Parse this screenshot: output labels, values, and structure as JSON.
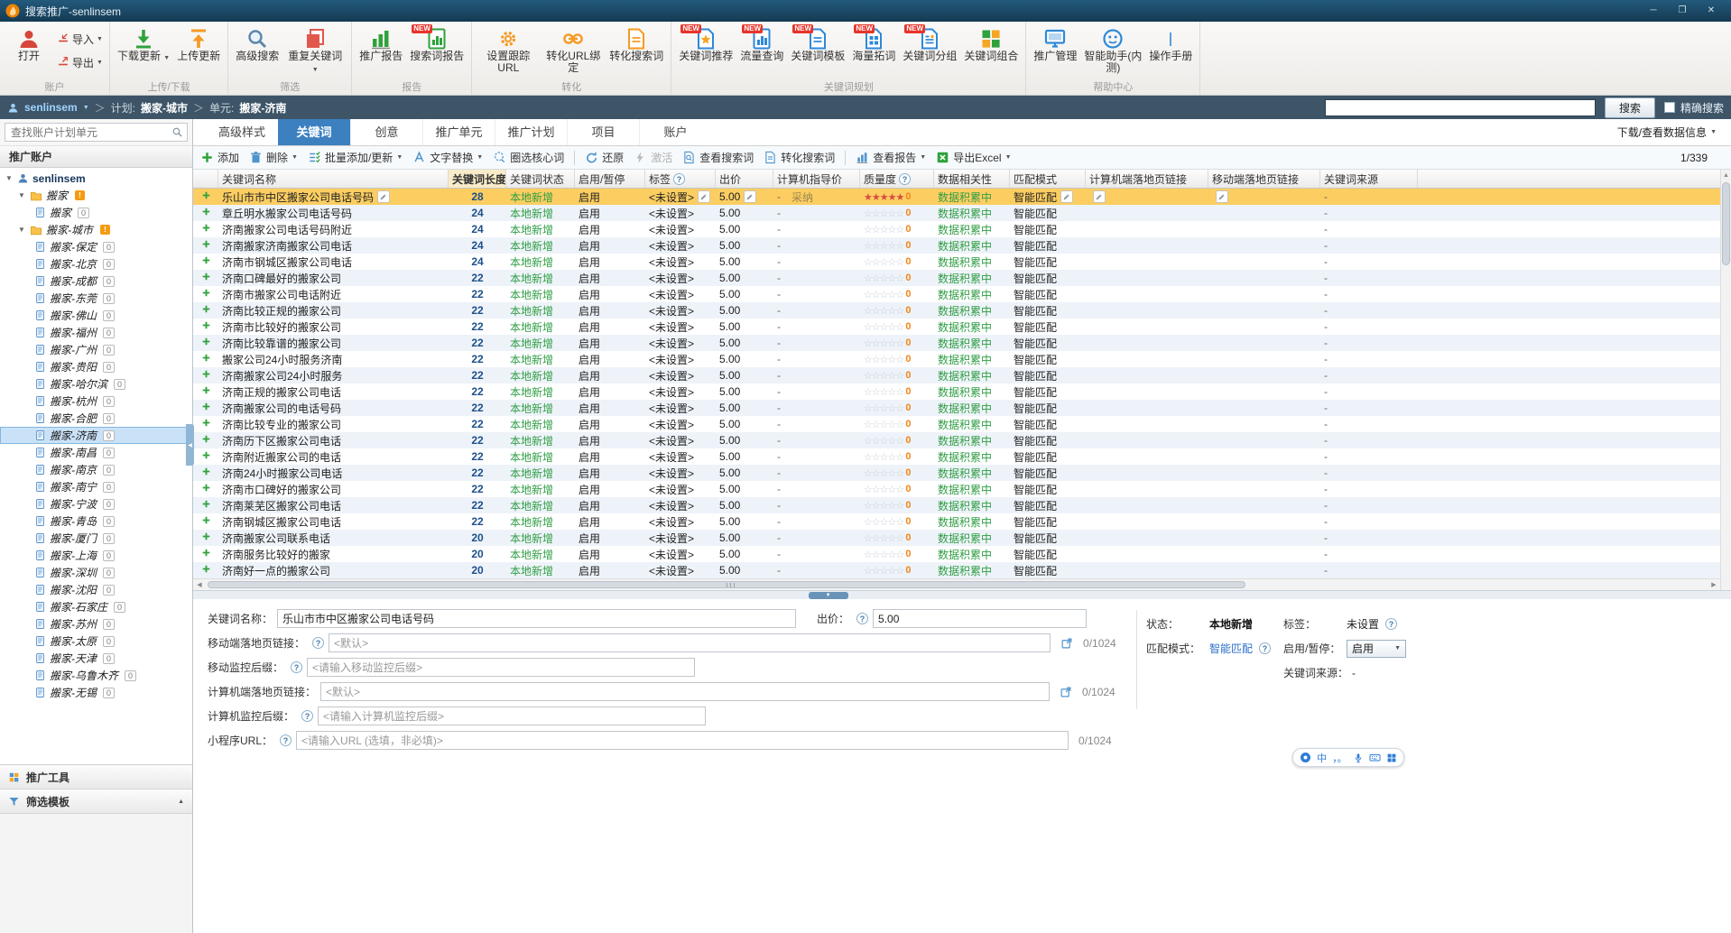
{
  "window": {
    "title": "搜索推广-senlinsem",
    "minimize_glyph": "─",
    "maximize_glyph": "❐",
    "close_glyph": "✕"
  },
  "icons": {
    "caret_down": "▼",
    "caret_up": "▲",
    "tri_left": "◀",
    "tri_right": "▶",
    "info": "?",
    "star_empty": "☆",
    "star_filled": "★",
    "flag": "!"
  },
  "colors": {
    "titlebar": "#153a52",
    "crumbbar": "#3e5568",
    "active_tab": "#3c80c0",
    "selected_row": "#fcce62",
    "status_green": "#2f9e44",
    "link_blue": "#2a6fc9",
    "quality_orange": "#f08519"
  },
  "ribbon": {
    "groups": [
      {
        "label": "账户",
        "items": [
          {
            "label": "打开",
            "icon": "person",
            "color": "#d6453a"
          },
          {
            "label": "导入",
            "icon": "arrow-import",
            "color": "#d6453a",
            "small": true,
            "arrow": true
          },
          {
            "label": "导出",
            "icon": "arrow-export",
            "color": "#d6453a",
            "small": true,
            "arrow": true
          }
        ]
      },
      {
        "label": "上传/下载",
        "items": [
          {
            "label": "下载更新",
            "icon": "arrow-down",
            "color": "#2fa23c",
            "arrow": true
          },
          {
            "label": "上传更新",
            "icon": "arrow-up",
            "color": "#f59a23"
          }
        ]
      },
      {
        "label": "筛选",
        "items": [
          {
            "label": "高级搜索",
            "icon": "magnifier",
            "color": "#5b87ad"
          },
          {
            "label": "重复关键词",
            "icon": "copy",
            "color": "#e2574c",
            "arrow": true
          }
        ]
      },
      {
        "label": "报告",
        "items": [
          {
            "label": "推广报告",
            "icon": "chart",
            "color": "#2fa23c"
          },
          {
            "label": "搜索词报告",
            "icon": "doc-chart",
            "color": "#2fa23c",
            "badge": "NEW"
          }
        ]
      },
      {
        "label": "转化",
        "items": [
          {
            "label": "设置跟踪URL",
            "icon": "gear",
            "color": "#f59a23"
          },
          {
            "label": "转化URL绑定",
            "icon": "link",
            "color": "#f59a23"
          },
          {
            "label": "转化搜索词",
            "icon": "doc",
            "color": "#f59a23"
          }
        ]
      },
      {
        "label": "关键词规划",
        "items": [
          {
            "label": "关键词推荐",
            "icon": "doc-star",
            "color": "#2e89d8",
            "badge": "NEW"
          },
          {
            "label": "流量查询",
            "icon": "doc-chart",
            "color": "#2e89d8",
            "badge": "NEW"
          },
          {
            "label": "关键词模板",
            "icon": "doc",
            "color": "#2e89d8",
            "badge": "NEW"
          },
          {
            "label": "海量拓词",
            "icon": "doc-grid",
            "color": "#2e89d8",
            "badge": "NEW"
          },
          {
            "label": "关键词分组",
            "icon": "doc-group",
            "color": "#2e89d8",
            "badge": "NEW"
          },
          {
            "label": "关键词组合",
            "icon": "grid",
            "color": "#2fa23c"
          }
        ]
      },
      {
        "label": "帮助中心",
        "items": [
          {
            "label": "推广管理",
            "icon": "monitor",
            "color": "#2e89d8"
          },
          {
            "label": "智能助手(内测)",
            "icon": "assistant",
            "color": "#2e89d8"
          },
          {
            "label": "操作手册",
            "icon": "book",
            "color": "#2e89d8"
          }
        ]
      }
    ]
  },
  "breadcrumb": {
    "account": "senlinsem",
    "sep": "＞",
    "plan_label": "计划:",
    "plan_value": "搬家-城市",
    "unit_label": "单元:",
    "unit_value": "搬家-济南",
    "search_button": "搜索",
    "exact_label": "精确搜索"
  },
  "sidebar": {
    "search_placeholder": "查找账户计划单元",
    "section_title": "推广账户",
    "tools_label": "推广工具",
    "template_label": "筛选模板",
    "tree": {
      "root": "senlinsem",
      "groups": [
        {
          "label": "搬家",
          "children": [
            {
              "label": "搬家",
              "badge": "0"
            }
          ]
        },
        {
          "label": "搬家-城市",
          "children": [
            {
              "label": "搬家-保定",
              "badge": "0"
            },
            {
              "label": "搬家-北京",
              "badge": "0"
            },
            {
              "label": "搬家-成都",
              "badge": "0"
            },
            {
              "label": "搬家-东莞",
              "badge": "0"
            },
            {
              "label": "搬家-佛山",
              "badge": "0"
            },
            {
              "label": "搬家-福州",
              "badge": "0"
            },
            {
              "label": "搬家-广州",
              "badge": "0"
            },
            {
              "label": "搬家-贵阳",
              "badge": "0"
            },
            {
              "label": "搬家-哈尔滨",
              "badge": "0"
            },
            {
              "label": "搬家-杭州",
              "badge": "0"
            },
            {
              "label": "搬家-合肥",
              "badge": "0"
            },
            {
              "label": "搬家-济南",
              "badge": "0",
              "selected": true
            },
            {
              "label": "搬家-南昌",
              "badge": "0"
            },
            {
              "label": "搬家-南京",
              "badge": "0"
            },
            {
              "label": "搬家-南宁",
              "badge": "0"
            },
            {
              "label": "搬家-宁波",
              "badge": "0"
            },
            {
              "label": "搬家-青岛",
              "badge": "0"
            },
            {
              "label": "搬家-厦门",
              "badge": "0"
            },
            {
              "label": "搬家-上海",
              "badge": "0"
            },
            {
              "label": "搬家-深圳",
              "badge": "0"
            },
            {
              "label": "搬家-沈阳",
              "badge": "0"
            },
            {
              "label": "搬家-石家庄",
              "badge": "0"
            },
            {
              "label": "搬家-苏州",
              "badge": "0"
            },
            {
              "label": "搬家-太原",
              "badge": "0"
            },
            {
              "label": "搬家-天津",
              "badge": "0"
            },
            {
              "label": "搬家-乌鲁木齐",
              "badge": "0"
            },
            {
              "label": "搬家-无锡",
              "badge": "0"
            }
          ]
        }
      ]
    }
  },
  "tabs": {
    "items": [
      "高级样式",
      "关键词",
      "创意",
      "推广单元",
      "推广计划",
      "项目",
      "账户"
    ],
    "active": "关键词",
    "right_link": "下载/查看数据信息"
  },
  "toolbar": {
    "items": [
      {
        "label": "添加",
        "icon": "plus",
        "color": "#2fa23c"
      },
      {
        "label": "删除",
        "icon": "trash",
        "color": "#4f94cd",
        "arrow": true
      },
      {
        "label": "批量添加/更新",
        "icon": "list-check",
        "color": "#4f94cd",
        "arrow": true
      },
      {
        "label": "文字替换",
        "icon": "font",
        "color": "#4f94cd",
        "arrow": true
      },
      {
        "label": "圈选核心词",
        "icon": "lasso",
        "color": "#4f94cd"
      },
      {
        "sep": true
      },
      {
        "label": "还原",
        "icon": "undo",
        "color": "#4f94cd"
      },
      {
        "label": "激活",
        "icon": "bolt",
        "color": "#b9b9b9",
        "disabled": true
      },
      {
        "label": "查看搜索词",
        "icon": "doc-search",
        "color": "#4f94cd"
      },
      {
        "label": "转化搜索词",
        "icon": "doc",
        "color": "#4f94cd"
      },
      {
        "sep": true
      },
      {
        "label": "查看报告",
        "icon": "chart",
        "color": "#4f94cd",
        "arrow": true
      },
      {
        "label": "导出Excel",
        "icon": "excel",
        "color": "#2fa23c",
        "arrow": true
      }
    ],
    "page_indicator": "1/339"
  },
  "table": {
    "columns": [
      {
        "key": "plus",
        "label": ""
      },
      {
        "key": "name",
        "label": "关键词名称"
      },
      {
        "key": "length",
        "label": "关键词长度",
        "sorted": true
      },
      {
        "key": "status",
        "label": "关键词状态"
      },
      {
        "key": "enable",
        "label": "启用/暂停"
      },
      {
        "key": "tag",
        "label": "标签",
        "info": true
      },
      {
        "key": "bid",
        "label": "出价"
      },
      {
        "key": "guide",
        "label": "计算机指导价"
      },
      {
        "key": "quality",
        "label": "质量度",
        "info": true
      },
      {
        "key": "relevance",
        "label": "数据相关性"
      },
      {
        "key": "match",
        "label": "匹配模式"
      },
      {
        "key": "pc_link",
        "label": "计算机端落地页链接"
      },
      {
        "key": "mobile_link",
        "label": "移动端落地页链接"
      },
      {
        "key": "source",
        "label": "关键词来源"
      }
    ],
    "row_defaults": {
      "status": "本地新增",
      "enable": "启用",
      "tag": "<未设置>",
      "bid": "5.00",
      "guide": "-",
      "quality": "0",
      "relevance": "数据积累中",
      "match": "智能匹配",
      "source": "-"
    },
    "adopt_label": "采纳",
    "rows": [
      {
        "name": "乐山市市中区搬家公司电话号码",
        "length": "28",
        "selected": true
      },
      {
        "name": "章丘明水搬家公司电话号码",
        "length": "24"
      },
      {
        "name": "济南搬家公司电话号码附近",
        "length": "24"
      },
      {
        "name": "济南搬家济南搬家公司电话",
        "length": "24"
      },
      {
        "name": "济南市钢城区搬家公司电话",
        "length": "24"
      },
      {
        "name": "济南口碑最好的搬家公司",
        "length": "22"
      },
      {
        "name": "济南市搬家公司电话附近",
        "length": "22"
      },
      {
        "name": "济南比较正规的搬家公司",
        "length": "22"
      },
      {
        "name": "济南市比较好的搬家公司",
        "length": "22"
      },
      {
        "name": "济南比较靠谱的搬家公司",
        "length": "22"
      },
      {
        "name": "搬家公司24小时服务济南",
        "length": "22"
      },
      {
        "name": "济南搬家公司24小时服务",
        "length": "22"
      },
      {
        "name": "济南正规的搬家公司电话",
        "length": "22"
      },
      {
        "name": "济南搬家公司的电话号码",
        "length": "22"
      },
      {
        "name": "济南比较专业的搬家公司",
        "length": "22"
      },
      {
        "name": "济南历下区搬家公司电话",
        "length": "22"
      },
      {
        "name": "济南附近搬家公司的电话",
        "length": "22"
      },
      {
        "name": "济南24小时搬家公司电话",
        "length": "22"
      },
      {
        "name": "济南市口碑好的搬家公司",
        "length": "22"
      },
      {
        "name": "济南莱芜区搬家公司电话",
        "length": "22"
      },
      {
        "name": "济南钢城区搬家公司电话",
        "length": "22"
      },
      {
        "name": "济南搬家公司联系电话",
        "length": "20"
      },
      {
        "name": "济南服务比较好的搬家",
        "length": "20"
      },
      {
        "name": "济南好一点的搬家公司",
        "length": "20"
      }
    ]
  },
  "detail": {
    "keyword_label": "关键词名称：",
    "keyword_value": "乐山市市中区搬家公司电话号码",
    "bid_label": "出价：",
    "bid_value": "5.00",
    "mobile_link_label": "移动端落地页链接：",
    "mobile_link_value": "<默认>",
    "mobile_link_count": "0/1024",
    "mobile_suffix_label": "移动监控后缀：",
    "mobile_suffix_placeholder": "<请输入移动监控后缀>",
    "pc_link_label": "计算机端落地页链接：",
    "pc_link_value": "<默认>",
    "pc_link_count": "0/1024",
    "pc_suffix_label": "计算机监控后缀：",
    "pc_suffix_placeholder": "<请输入计算机监控后缀>",
    "miniapp_label": "小程序URL：",
    "miniapp_placeholder": "<请输入URL (选填，非必填)>",
    "miniapp_count": "0/1024",
    "status_label": "状态：",
    "status_value": "本地新增",
    "match_label": "匹配模式：",
    "match_value": "智能匹配",
    "tag_label": "标签：",
    "tag_value": "未设置",
    "pause_label": "启用/暂停：",
    "pause_value": "启用",
    "source_label": "关键词来源：",
    "source_value": "-"
  },
  "ime": {
    "lang": "中",
    "punct": "，。"
  }
}
